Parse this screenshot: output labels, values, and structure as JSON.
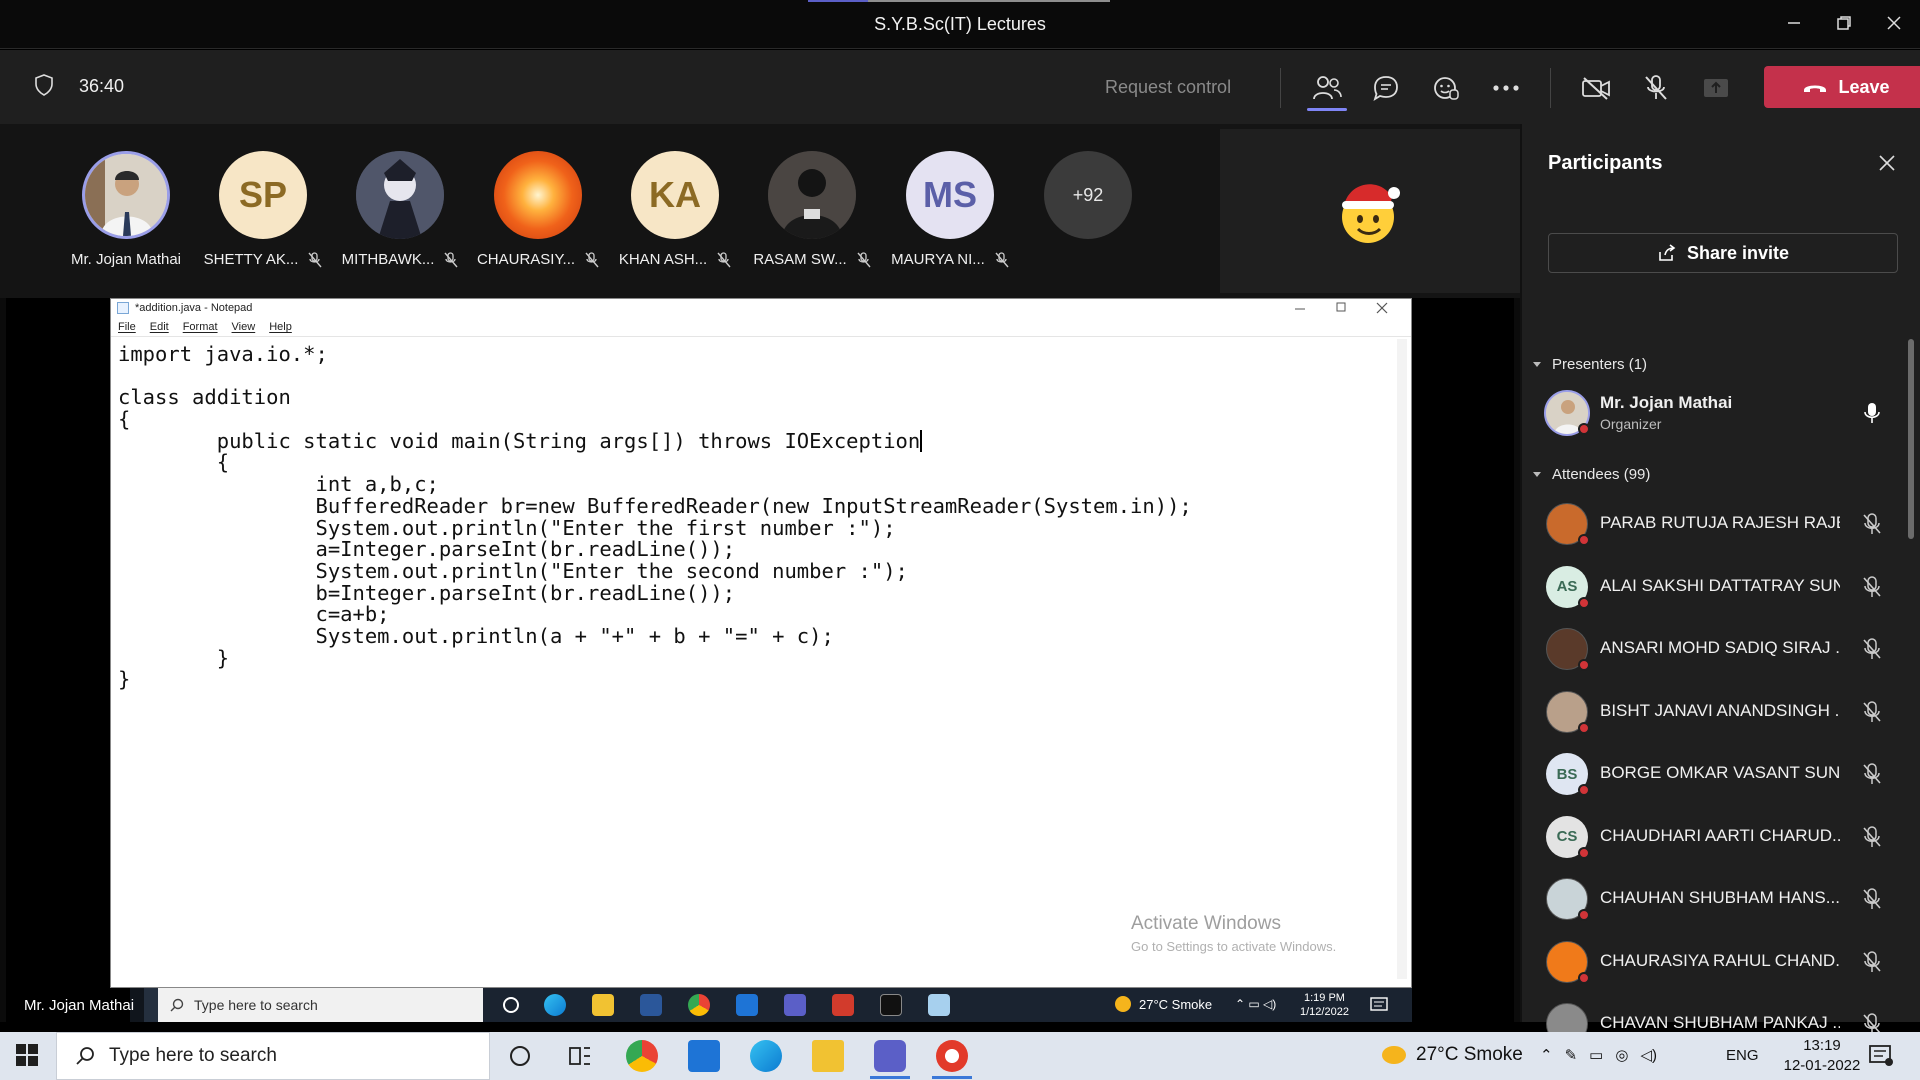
{
  "window": {
    "title": "S.Y.B.Sc(IT) Lectures"
  },
  "meeting": {
    "timer": "36:40",
    "request_control": "Request control",
    "leave_label": "Leave",
    "colors": {
      "leave": "#c4314b",
      "accent": "#7f85f5"
    }
  },
  "gallery": {
    "tiles": [
      {
        "name": "Mr. Jojan Mathai",
        "initials": "",
        "muted": false
      },
      {
        "name": "SHETTY AK...",
        "initials": "SP",
        "muted": true
      },
      {
        "name": "MITHBAWK...",
        "initials": "",
        "muted": true
      },
      {
        "name": "CHAURASIY...",
        "initials": "",
        "muted": true
      },
      {
        "name": "KHAN ASH...",
        "initials": "KA",
        "muted": true
      },
      {
        "name": "RASAM SW...",
        "initials": "",
        "muted": true
      },
      {
        "name": "MAURYA NI...",
        "initials": "MS",
        "muted": true
      }
    ],
    "more_count": "+92"
  },
  "notepad": {
    "title": "*addition.java - Notepad",
    "menu": [
      "File",
      "Edit",
      "Format",
      "View",
      "Help"
    ],
    "code_lines": [
      "import java.io.*;",
      "",
      "class addition",
      "{",
      "        public static void main(String args[]) throws IOException",
      "        {",
      "                int a,b,c;",
      "                BufferedReader br=new BufferedReader(new InputStreamReader(System.in));",
      "                System.out.println(\"Enter the first number :\");",
      "                a=Integer.parseInt(br.readLine());",
      "                System.out.println(\"Enter the second number :\");",
      "                b=Integer.parseInt(br.readLine());",
      "                c=a+b;",
      "                System.out.println(a + \"+\" + b + \"=\" + c);",
      "        }",
      "}"
    ],
    "activate_title": "Activate Windows",
    "activate_sub": "Go to Settings to activate Windows."
  },
  "inner_taskbar": {
    "search_placeholder": "Type here to search",
    "weather": "27°C  Smoke",
    "time": "1:19 PM",
    "date": "1/12/2022"
  },
  "presenter_label": "Mr. Jojan Mathai",
  "participants": {
    "title": "Participants",
    "share_invite": "Share invite",
    "presenters_header": "Presenters (1)",
    "attendees_header": "Attendees (99)",
    "presenters": [
      {
        "name": "Mr. Jojan Mathai",
        "role": "Organizer"
      }
    ],
    "attendees": [
      {
        "name": "PARAB RUTUJA RAJESH RAJE...",
        "initials": "",
        "color": "#c96a2c"
      },
      {
        "name": "ALAI SAKSHI DATTATRAY SUN...",
        "initials": "AS",
        "color": "#d9ede3"
      },
      {
        "name": "ANSARI MOHD SADIQ SIRAJ ...",
        "initials": "",
        "color": "#5a3a2a"
      },
      {
        "name": "BISHT JANAVI ANANDSINGH ...",
        "initials": "",
        "color": "#b9a08a"
      },
      {
        "name": "BORGE OMKAR VASANT SUN...",
        "initials": "BS",
        "color": "#dfe6f2"
      },
      {
        "name": "CHAUDHARI AARTI CHARUD...",
        "initials": "CS",
        "color": "#e3e3e3"
      },
      {
        "name": "CHAUHAN SHUBHAM HANS...",
        "initials": "",
        "color": "#c9d4d8"
      },
      {
        "name": "CHAURASIYA RAHUL CHAND...",
        "initials": "",
        "color": "#f07a1a"
      },
      {
        "name": "CHAVAN SHUBHAM PANKAJ ...",
        "initials": "",
        "color": "#8a8a8a"
      }
    ]
  },
  "host_taskbar": {
    "search_placeholder": "Type here to search",
    "weather": "27°C  Smoke",
    "language": "ENG",
    "time": "13:19",
    "date": "12-01-2022"
  }
}
